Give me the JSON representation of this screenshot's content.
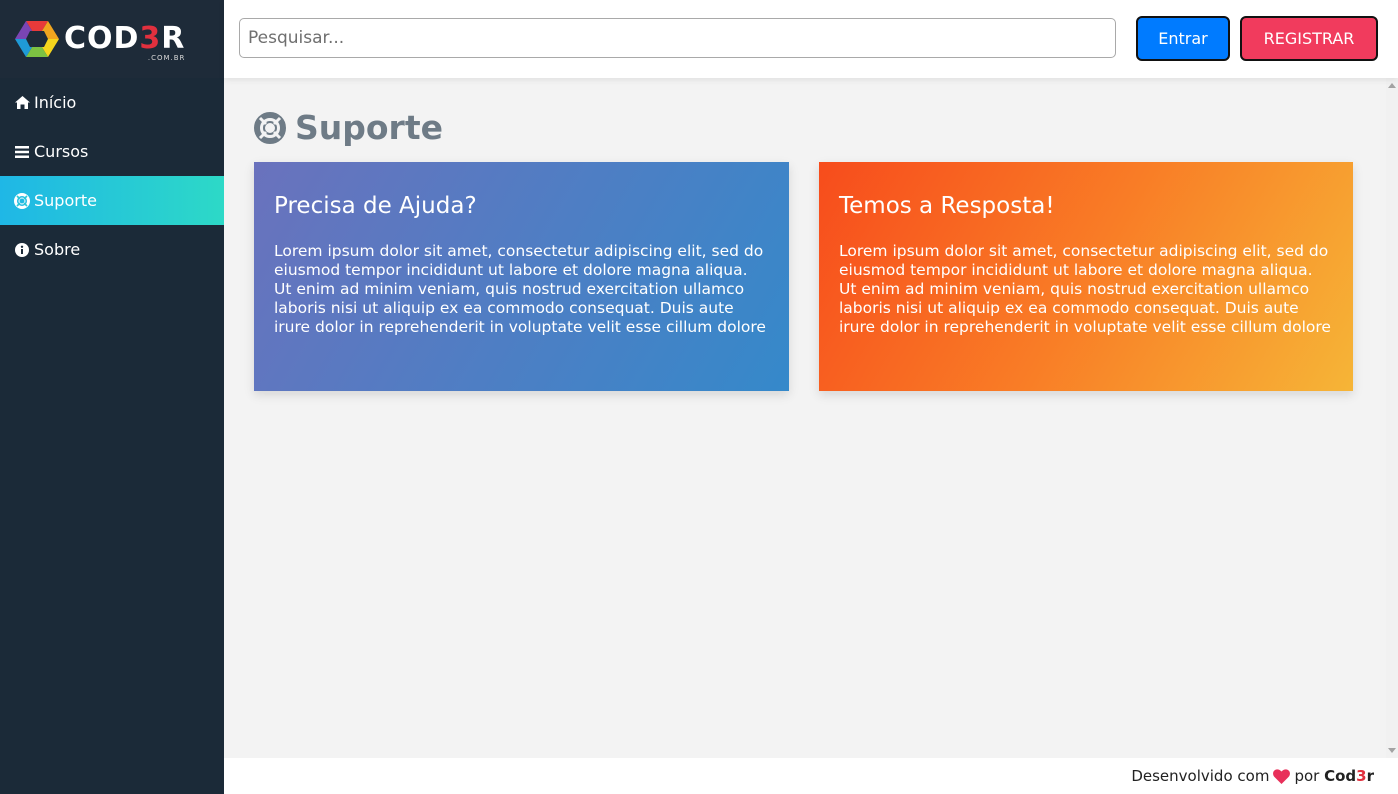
{
  "logo": {
    "word_start": "COD",
    "word_accent": "3",
    "word_end": "R",
    "subtitle": ".COM.BR"
  },
  "sidebar": {
    "items": [
      {
        "label": "Início",
        "icon": "home-icon",
        "active": false
      },
      {
        "label": "Cursos",
        "icon": "bars-icon",
        "active": false
      },
      {
        "label": "Suporte",
        "icon": "life-ring-icon",
        "active": true
      },
      {
        "label": "Sobre",
        "icon": "info-circle-icon",
        "active": false
      }
    ]
  },
  "header": {
    "search_placeholder": "Pesquisar...",
    "login_label": "Entrar",
    "register_label": "REGISTRAR"
  },
  "main": {
    "title": "Suporte",
    "title_icon": "life-ring-icon",
    "cards": [
      {
        "title": "Precisa de Ajuda?",
        "text": "Lorem ipsum dolor sit amet, consectetur adipiscing elit, sed do eiusmod tempor incididunt ut labore et dolore magna aliqua. Ut enim ad minim veniam, quis nostrud exercitation ullamco laboris nisi ut aliquip ex ea commodo consequat. Duis aute irure dolor in reprehenderit in voluptate velit esse cillum dolore"
      },
      {
        "title": "Temos a Resposta!",
        "text": "Lorem ipsum dolor sit amet, consectetur adipiscing elit, sed do eiusmod tempor incididunt ut labore et dolore magna aliqua. Ut enim ad minim veniam, quis nostrud exercitation ullamco laboris nisi ut aliquip ex ea commodo consequat. Duis aute irure dolor in reprehenderit in voluptate velit esse cillum dolore"
      }
    ]
  },
  "footer": {
    "prefix": "Desenvolvido com",
    "suffix": "por",
    "brand_start": "Cod",
    "brand_accent": "3",
    "brand_end": "r"
  },
  "colors": {
    "sidebar_bg": "#1b2a38",
    "active_item": "#1fb7e6",
    "login_button": "#007bff",
    "register_button": "#f13b5d",
    "accent_red": "#e1303e"
  }
}
